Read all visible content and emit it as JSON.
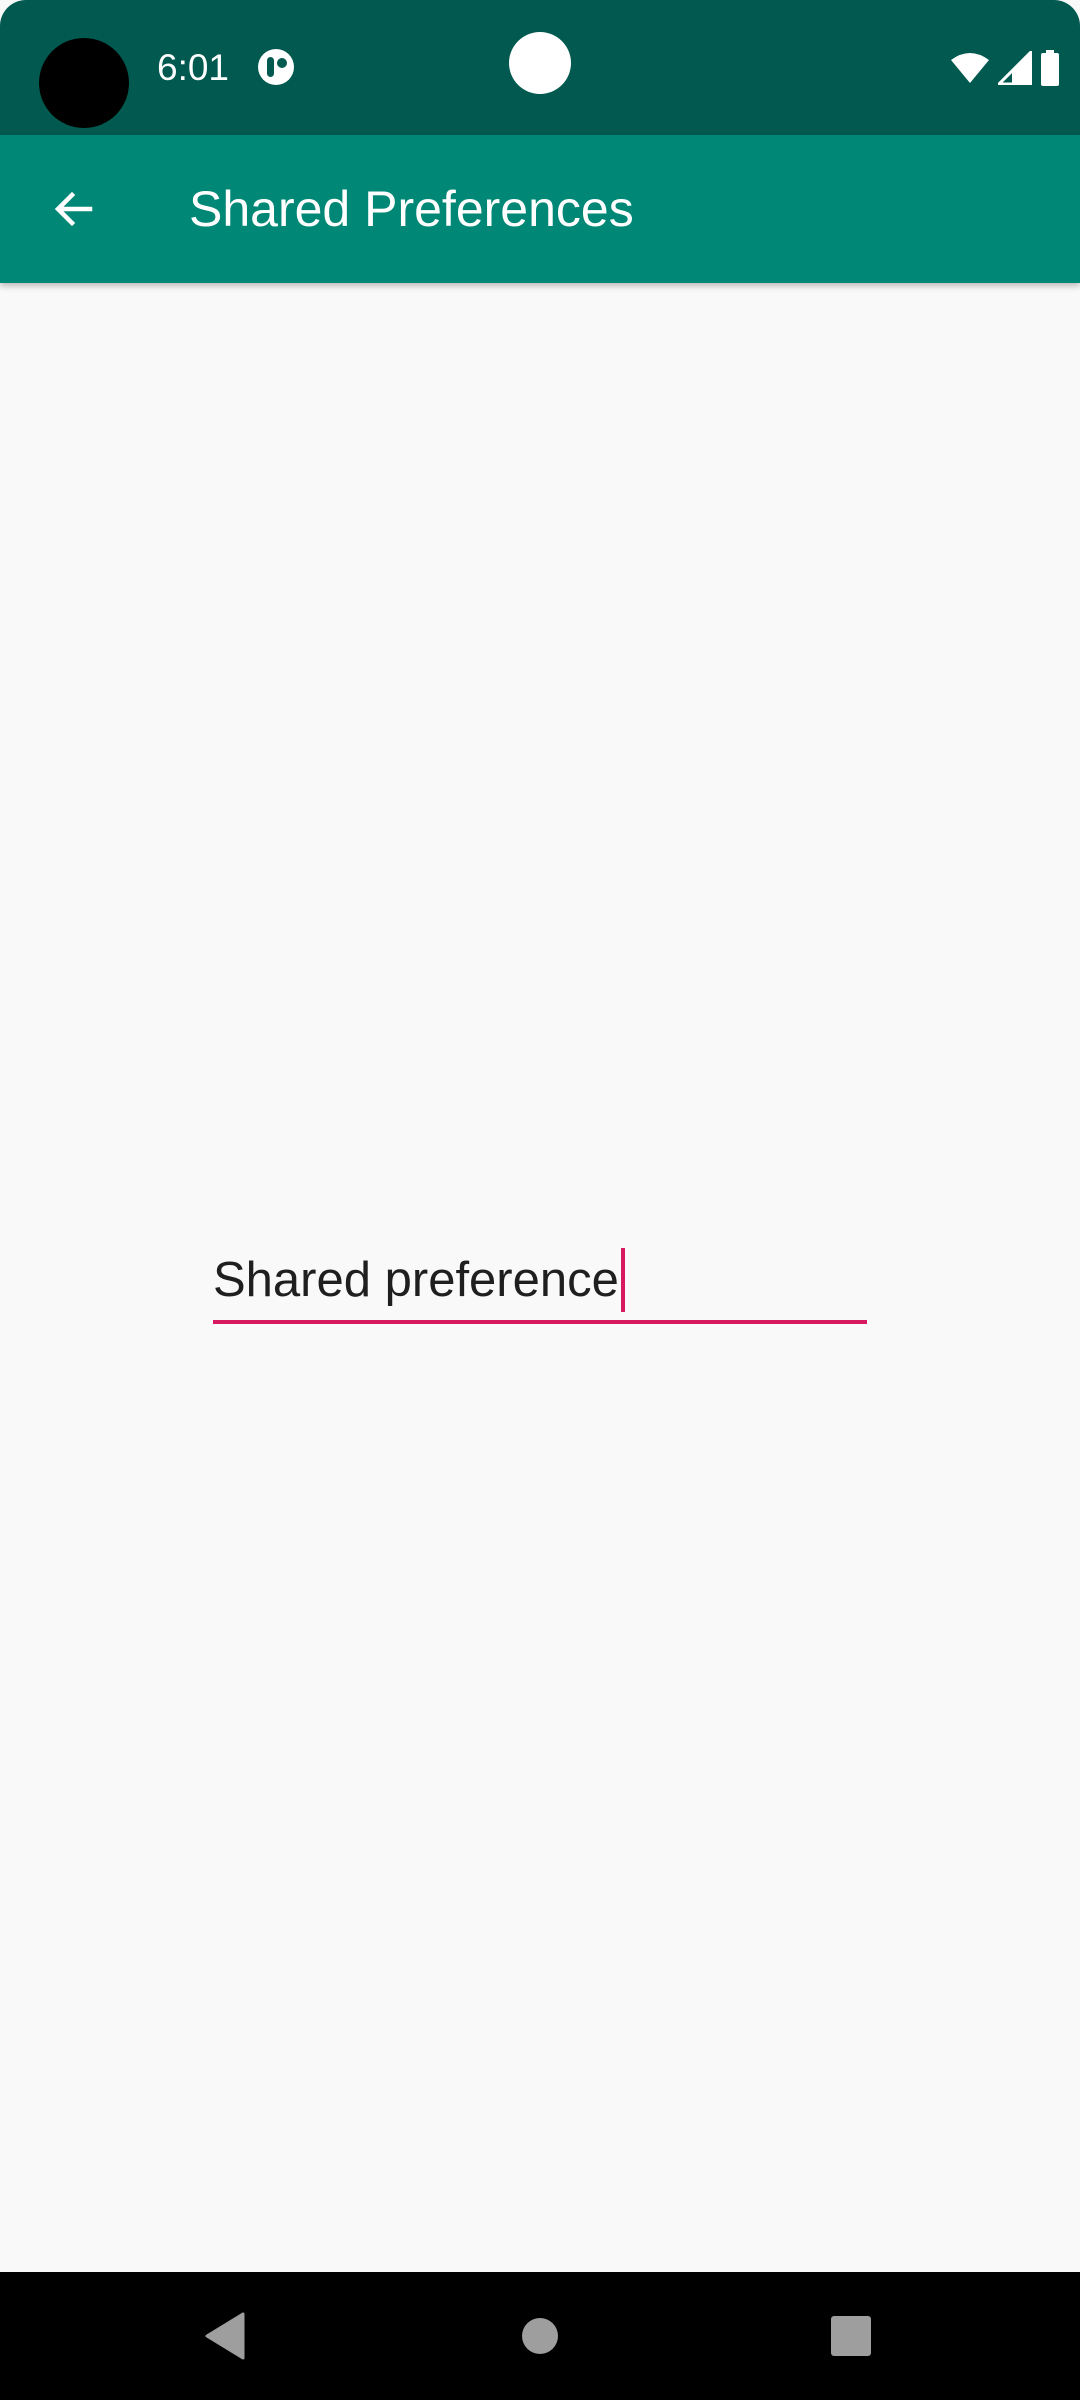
{
  "status_bar": {
    "time": "6:01",
    "icons": [
      "app-notification-icon",
      "wifi-icon",
      "cellular-signal-icon",
      "battery-icon"
    ]
  },
  "app_bar": {
    "title": "Shared Preferences",
    "back_icon": "arrow-back-icon"
  },
  "main": {
    "edit_text": {
      "value": "Shared preference"
    }
  },
  "nav_bar": {
    "buttons": [
      "back-triangle-icon",
      "home-circle-icon",
      "recents-square-icon"
    ]
  },
  "colors": {
    "status_bar": "#01594f",
    "app_bar": "#018776",
    "accent": "#d81b60",
    "background": "#f9f9f9"
  }
}
